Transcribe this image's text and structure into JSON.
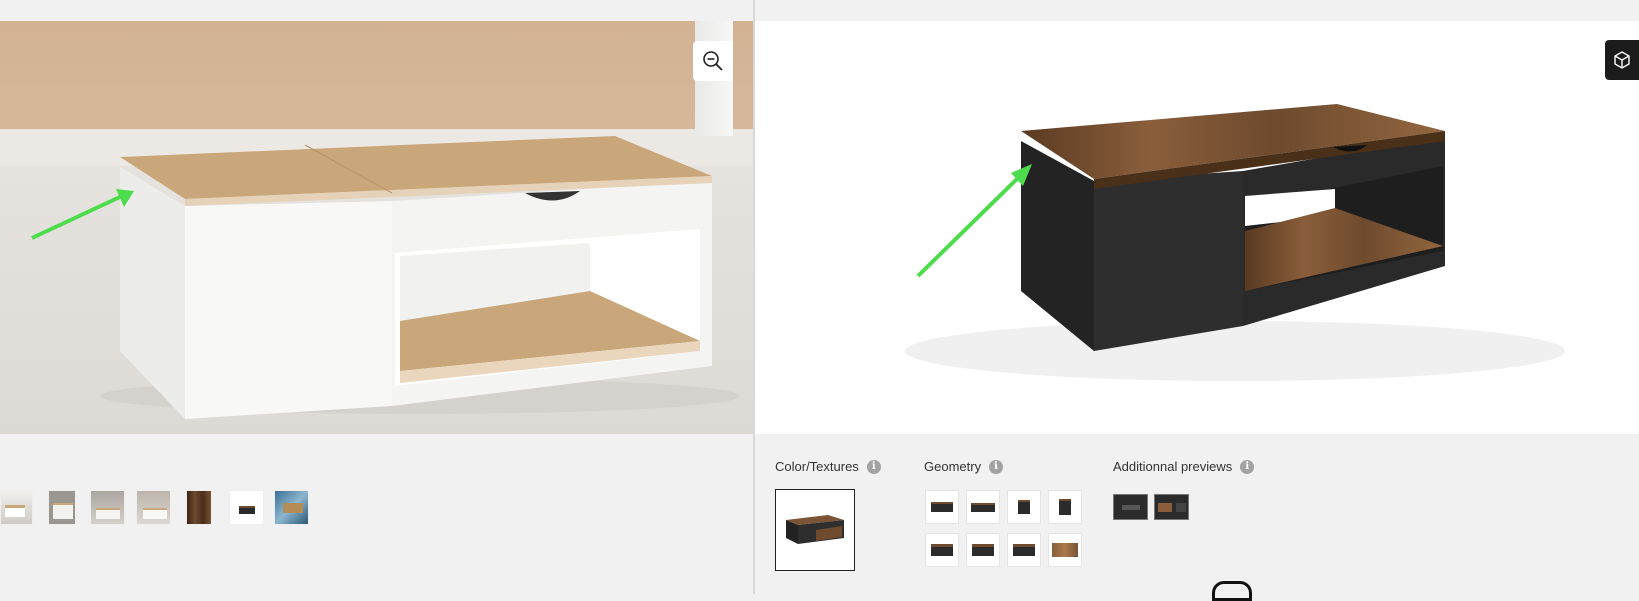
{
  "left_pane": {
    "zoom_icon": "zoom-out-icon",
    "thumbnails": [
      "table-scene",
      "table-white",
      "table-room-1",
      "table-room-2",
      "wood-texture",
      "table-black",
      "table-blue-scene"
    ]
  },
  "right_pane": {
    "view3d_icon": "cube-icon",
    "sections": {
      "colors": {
        "label": "Color/Textures",
        "info": "i"
      },
      "geometry": {
        "label": "Geometry",
        "info": "i"
      },
      "previews": {
        "label": "Additionnal previews",
        "info": "i"
      }
    }
  },
  "colors": {
    "wood_light": "#c9a77a",
    "wood_dark": "#6e4a2e",
    "black": "#2b2b2b",
    "arrow": "#4cdc4c"
  }
}
